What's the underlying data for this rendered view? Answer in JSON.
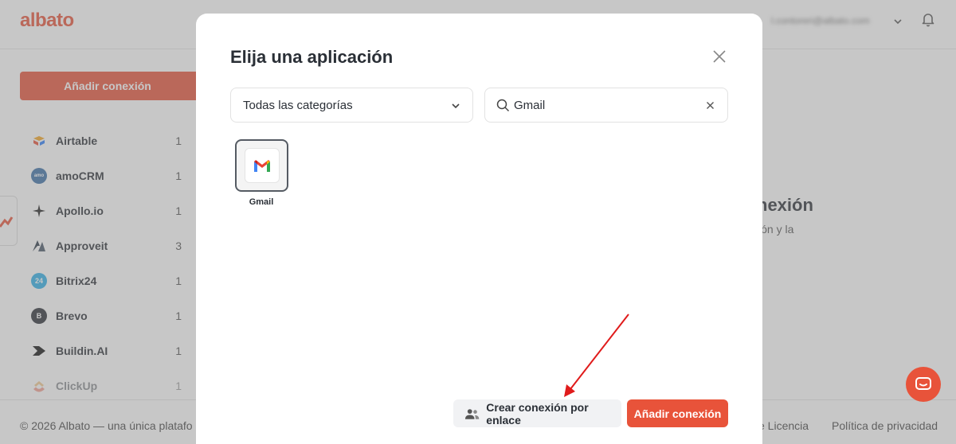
{
  "header": {
    "logo": "albato",
    "user_email": "l.contoreri@albato.com"
  },
  "sidebar": {
    "add_button": "Añadir conexión",
    "items": [
      {
        "label": "Airtable",
        "count": "1",
        "icon": "airtable-icon",
        "color": "#e8533a"
      },
      {
        "label": "amoCRM",
        "count": "1",
        "icon": "amocrm-icon",
        "color": "#3b6fa6"
      },
      {
        "label": "Apollo.io",
        "count": "1",
        "icon": "apollo-icon",
        "color": "#222222"
      },
      {
        "label": "Approveit",
        "count": "3",
        "icon": "approveit-icon",
        "color": "#2f3b4a"
      },
      {
        "label": "Bitrix24",
        "count": "1",
        "icon": "bitrix24-icon",
        "color": "#2fb0e8"
      },
      {
        "label": "Brevo",
        "count": "1",
        "icon": "brevo-icon",
        "color": "#2a2f36"
      },
      {
        "label": "Buildin.AI",
        "count": "1",
        "icon": "buildin-icon",
        "color": "#111111"
      },
      {
        "label": "ClickUp",
        "count": "1",
        "icon": "clickup-icon",
        "color": "#e8533a"
      }
    ],
    "bitrix_badge": "24",
    "amocrm_badge": "amo"
  },
  "background": {
    "heading": "nexión",
    "sub": "ión y la"
  },
  "footer": {
    "copyright": "© 2026 Albato — una única platafo",
    "license": "e Licencia",
    "privacy": "Política de privacidad"
  },
  "modal": {
    "title": "Elija una aplicación",
    "category_select": "Todas las categorías",
    "search_value": "Gmail",
    "apps": [
      {
        "label": "Gmail",
        "icon": "gmail-icon"
      }
    ],
    "link_button": "Crear conexión por enlace",
    "add_button": "Añadir conexión"
  },
  "colors": {
    "accent": "#e8533a",
    "annotation": "#e01b1b"
  }
}
